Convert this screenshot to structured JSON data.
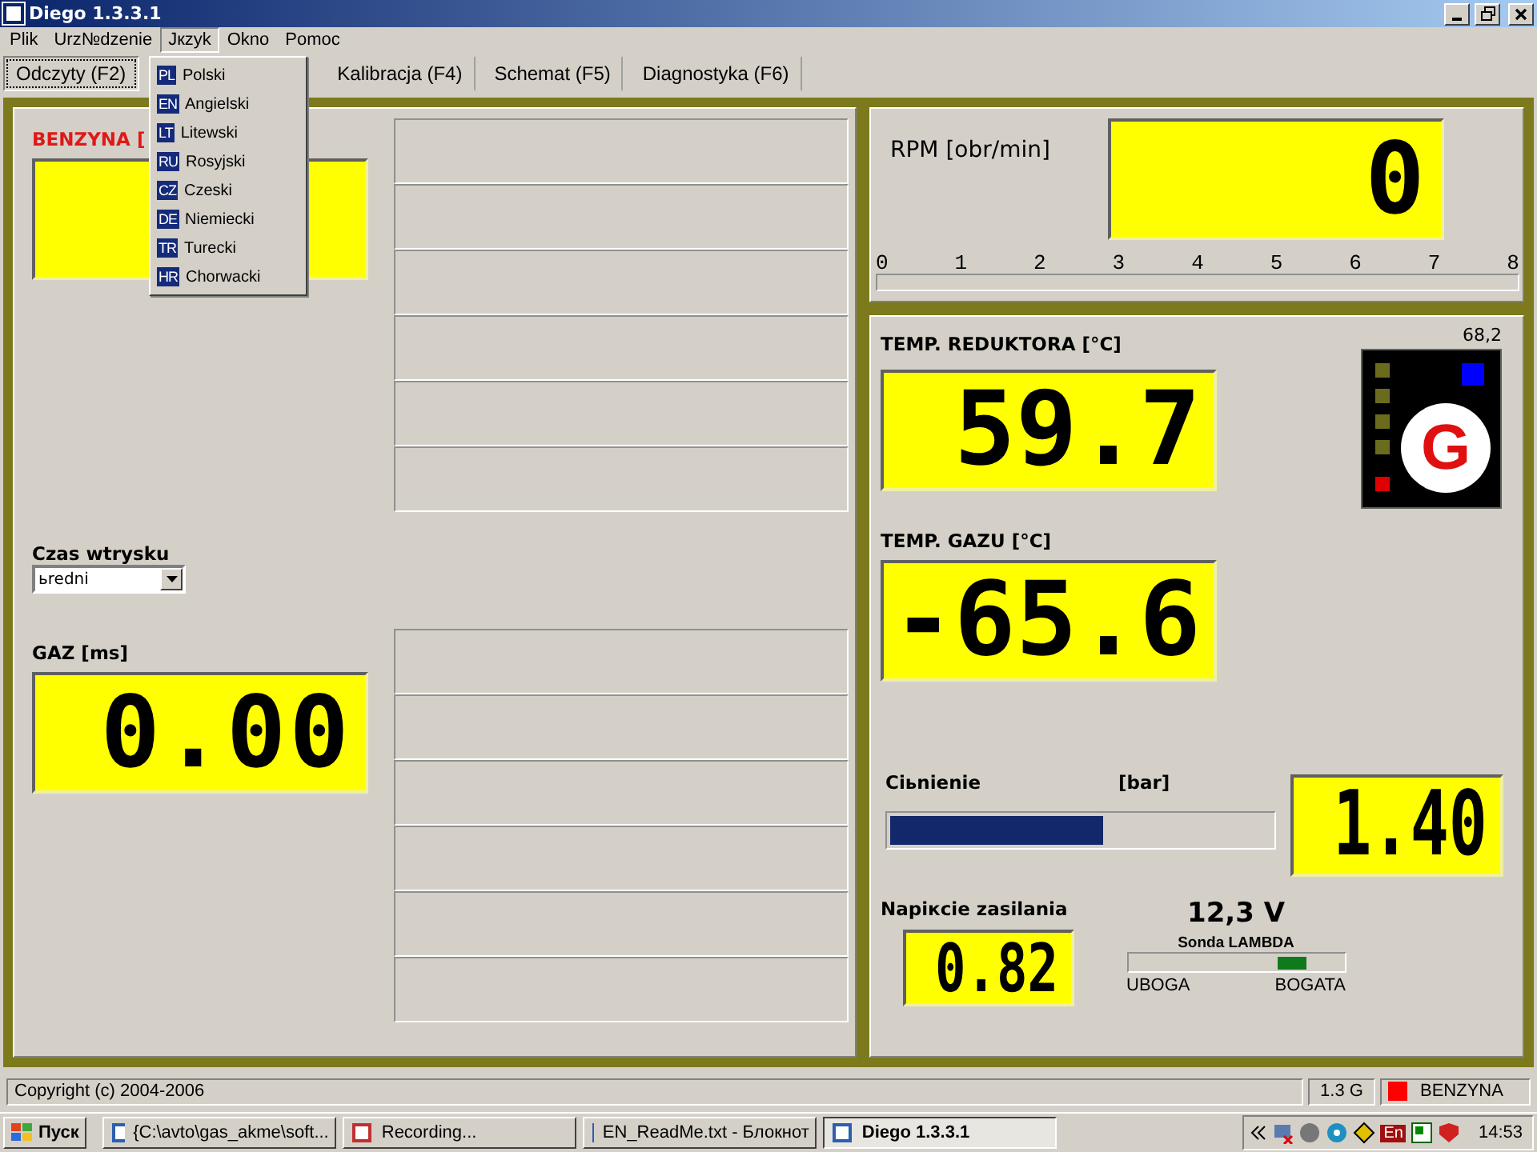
{
  "window": {
    "title": "Diego 1.3.3.1"
  },
  "menubar": [
    {
      "label": "Plik",
      "selected": false
    },
    {
      "label": "Urz№dzenie",
      "selected": false
    },
    {
      "label": "Jкzyk",
      "selected": true
    },
    {
      "label": "Okno",
      "selected": false
    },
    {
      "label": "Pomoc",
      "selected": false
    }
  ],
  "language_menu": [
    {
      "code": "PL",
      "label": "Polski"
    },
    {
      "code": "EN",
      "label": "Angielski"
    },
    {
      "code": "LT",
      "label": "Litewski"
    },
    {
      "code": "RU",
      "label": "Rosyjski"
    },
    {
      "code": "CZ",
      "label": "Czeski"
    },
    {
      "code": "DE",
      "label": "Niemiecki"
    },
    {
      "code": "TR",
      "label": "Turecki"
    },
    {
      "code": "HR",
      "label": "Chorwacki"
    }
  ],
  "tabs": [
    {
      "label": "Odczyty (F2)",
      "selected": true
    },
    {
      "label": "Kalibracja (F4)",
      "selected": false
    },
    {
      "label": "Schemat (F5)",
      "selected": false
    },
    {
      "label": "Diagnostyka (F6)",
      "selected": false
    }
  ],
  "left": {
    "benzyna_label": "BENZYNA [",
    "injection_label": "Czas wtrysku",
    "injection_mode": "ьredni",
    "gaz_label": "GAZ [ms]",
    "gaz_value": "0.00"
  },
  "rpm": {
    "label": "RPM [obr/min]",
    "value": "0",
    "scale": [
      "0",
      "1",
      "2",
      "3",
      "4",
      "5",
      "6",
      "7",
      "8"
    ]
  },
  "reducer_temp": {
    "label": "TEMP. REDUKTORA [°C]",
    "value": "59.7"
  },
  "indicator": {
    "reading": "68,2",
    "letter": "G",
    "leds": [
      {
        "color": "#6b6b1e"
      },
      {
        "color": "#6b6b1e"
      },
      {
        "color": "#6b6b1e"
      },
      {
        "color": "#6b6b1e"
      },
      {
        "color": "#e00000"
      }
    ]
  },
  "gas_temp": {
    "label": "TEMP. GAZU [°C]",
    "value": "-65.6"
  },
  "pressure": {
    "label": "Ciьnienie",
    "unit": "[bar]",
    "level": 0.56,
    "value": "1.40"
  },
  "supply": {
    "label": "Napiкcie zasilania",
    "value": "0.82",
    "voltage": "12,3 V"
  },
  "lambda": {
    "label": "Sonda LAMBDA",
    "level": 0.76,
    "low": "UBOGA",
    "high": "BOGATA"
  },
  "status_bar": {
    "copyright": "Copyright (c) 2004-2006",
    "version": "1.3 G",
    "mode": "BENZYNA"
  },
  "taskbar": {
    "start": "Пуск",
    "tasks": [
      {
        "label": "{C:\\avto\\gas_akme\\soft...",
        "selected": false
      },
      {
        "label": "Recording...",
        "selected": false
      },
      {
        "label": "EN_ReadMe.txt - Блокнот",
        "selected": false
      },
      {
        "label": "Diego 1.3.3.1",
        "selected": true
      }
    ],
    "tray_lang": "En",
    "clock": "14:53"
  }
}
